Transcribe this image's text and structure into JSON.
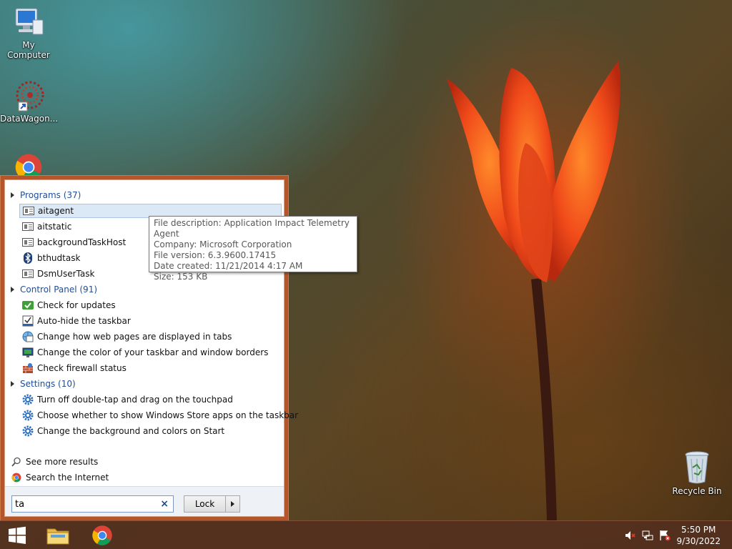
{
  "desktop": {
    "icons": [
      {
        "label": "My Computer",
        "icon": "computer-icon"
      },
      {
        "label": "DataWagon...",
        "icon": "datawagon-shortcut-icon"
      },
      {
        "label": "",
        "icon": "chrome-icon"
      },
      {
        "label": "Recycle Bin",
        "icon": "recycle-bin-icon"
      }
    ]
  },
  "search": {
    "groups": [
      {
        "title": "Programs (37)",
        "items": [
          "aitagent",
          "aitstatic",
          "backgroundTaskHost",
          "bthudtask",
          "DsmUserTask"
        ]
      },
      {
        "title": "Control Panel (91)",
        "items": [
          "Check for updates",
          "Auto-hide the taskbar",
          "Change how web pages are displayed in tabs",
          "Change the color of your taskbar and window borders",
          "Check firewall status"
        ]
      },
      {
        "title": "Settings (10)",
        "items": [
          "Turn off double-tap and drag on the touchpad",
          "Choose whether to show Windows Store apps on the taskbar",
          "Change the background and colors on Start"
        ]
      }
    ],
    "see_more": "See more results",
    "search_internet": "Search the Internet",
    "query": "ta",
    "clear_glyph": "×",
    "lock_label": "Lock"
  },
  "tooltip": {
    "lines": [
      "File description: Application Impact Telemetry Agent",
      "Company: Microsoft Corporation",
      "File version: 6.3.9600.17415",
      "Date created: 11/21/2014 4:17 AM",
      "Size: 153 KB"
    ]
  },
  "taskbar": {
    "time": "5:50 PM",
    "date": "9/30/2022"
  },
  "colors": {
    "accent": "#b4562a",
    "link_blue": "#1e4e9a"
  }
}
